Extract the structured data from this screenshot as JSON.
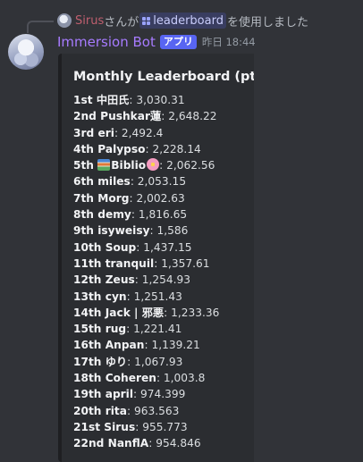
{
  "reply": {
    "user": "Sirus",
    "suffix_before": "さんが",
    "command": "leaderboard",
    "suffix_after": "を使用しました"
  },
  "message": {
    "bot_name": "Immersion Bot",
    "app_tag": "アプリ",
    "timestamp": "昨日 18:44"
  },
  "embed": {
    "title": "Monthly Leaderboard (pts)",
    "entries": [
      {
        "rank": "1st",
        "name": "中田氏",
        "value": "3,030.31"
      },
      {
        "rank": "2nd",
        "name": "Pushkar蓮",
        "value": "2,648.22"
      },
      {
        "rank": "3rd",
        "name": "eri",
        "value": "2,492.4"
      },
      {
        "rank": "4th",
        "name": "Palypso",
        "value": "2,228.14"
      },
      {
        "rank": "5th",
        "name": "Biblio",
        "value": "2,062.56"
      },
      {
        "rank": "6th",
        "name": "miles",
        "value": "2,053.15"
      },
      {
        "rank": "7th",
        "name": "Morg",
        "value": "2,002.63"
      },
      {
        "rank": "8th",
        "name": "demy",
        "value": "1,816.65"
      },
      {
        "rank": "9th",
        "name": "isyweisy",
        "value": "1,586"
      },
      {
        "rank": "10th",
        "name": "Soup",
        "value": "1,437.15"
      },
      {
        "rank": "11th",
        "name": "tranquil",
        "value": "1,357.61"
      },
      {
        "rank": "12th",
        "name": "Zeus",
        "value": "1,254.93"
      },
      {
        "rank": "13th",
        "name": "cyn",
        "value": "1,251.43"
      },
      {
        "rank": "14th",
        "name": "Jack | 邪悪",
        "value": "1,233.36"
      },
      {
        "rank": "15th",
        "name": "rug",
        "value": "1,221.41"
      },
      {
        "rank": "16th",
        "name": "Anpan",
        "value": "1,139.21"
      },
      {
        "rank": "17th",
        "name": "ゆり",
        "value": "1,067.93"
      },
      {
        "rank": "18th",
        "name": "Coheren",
        "value": "1,003.8"
      },
      {
        "rank": "19th",
        "name": "april",
        "value": "974.399"
      },
      {
        "rank": "20th",
        "name": "rita",
        "value": "963.563"
      },
      {
        "rank": "21st",
        "name": "Sirus",
        "value": "955.773"
      },
      {
        "rank": "22nd",
        "name": "NanflA",
        "value": "954.846"
      }
    ]
  },
  "colors": {
    "background": "#313338",
    "embed_bg": "#2b2d31",
    "bot_name": "#a77bff",
    "app_tag": "#5865f2",
    "reply_user": "#c05f6f"
  }
}
